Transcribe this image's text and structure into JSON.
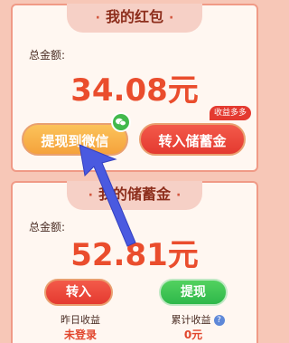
{
  "wallet": {
    "title": "我的红包",
    "title_dot": "·",
    "total_label": "总金额:",
    "amount": "34.08元",
    "withdraw_wechat_label": "提现到微信",
    "transfer_in_label": "转入储蓄金",
    "earn_more_badge": "收益多多"
  },
  "savings": {
    "title": "我的储蓄金",
    "title_dot": "·",
    "total_label": "总金额:",
    "amount": "52.81元",
    "transfer_in_label": "转入",
    "withdraw_label": "提现",
    "yesterday_label": "昨日收益",
    "yesterday_value": "未登录",
    "cumulative_label": "累计收益",
    "cumulative_value": "0元",
    "help_glyph": "?"
  },
  "colors": {
    "accent_red": "#ea4d2d",
    "arrow_blue": "#4a5ae0",
    "wechat_green": "#42b94c"
  }
}
